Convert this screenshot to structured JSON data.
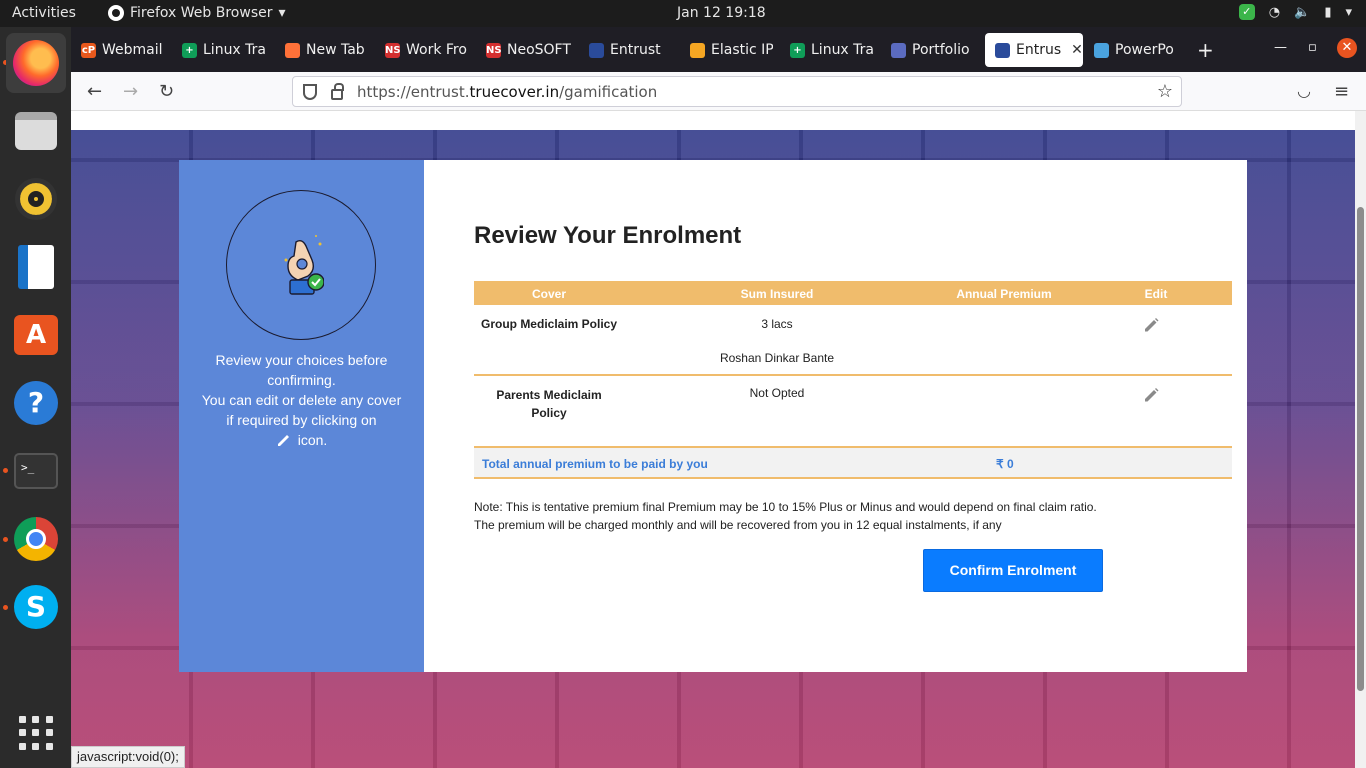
{
  "topbar": {
    "activities": "Activities",
    "app_name": "Firefox Web Browser",
    "clock": "Jan 12  19:18"
  },
  "dock": {
    "items": [
      "firefox",
      "files",
      "rhythmbox",
      "writer",
      "software",
      "help",
      "terminal",
      "chrome",
      "skype",
      "show-apps"
    ]
  },
  "tabs": [
    {
      "label": "Webmail",
      "favicon_color": "#e8581c",
      "favicon_text": "cP"
    },
    {
      "label": "Linux Tra",
      "favicon_color": "#0f9d58",
      "favicon_text": "+"
    },
    {
      "label": "New Tab",
      "favicon_color": "#ff7139",
      "favicon_text": ""
    },
    {
      "label": "Work Fro",
      "favicon_color": "#d32f2f",
      "favicon_text": "NS"
    },
    {
      "label": "NeoSOFT",
      "favicon_color": "#d32f2f",
      "favicon_text": "NS"
    },
    {
      "label": "Entrust",
      "favicon_color": "#2a4b9b",
      "favicon_text": ""
    },
    {
      "label": "Elastic IP",
      "favicon_color": "#f5a623",
      "favicon_text": ""
    },
    {
      "label": "Linux Tra",
      "favicon_color": "#0f9d58",
      "favicon_text": "+"
    },
    {
      "label": "Portfolio",
      "favicon_color": "#5b6bc0",
      "favicon_text": ""
    },
    {
      "label": "Entrus",
      "favicon_color": "#2a4b9b",
      "favicon_text": "",
      "active": true
    },
    {
      "label": "PowerPo",
      "favicon_color": "#4aa3df",
      "favicon_text": ""
    }
  ],
  "navbar": {
    "url_prefix": "https://entrust.",
    "url_host": "truecover.in",
    "url_path": "/gamification"
  },
  "sidebar": {
    "line1": "Review your choices before confirming.",
    "line2": "You can edit or delete any cover if required by clicking on",
    "line3": "icon."
  },
  "main": {
    "title": "Review Your Enrolment",
    "columns": [
      "Cover",
      "Sum Insured",
      "Annual Premium",
      "Edit"
    ],
    "rows": [
      {
        "cover": "Group Mediclaim Policy",
        "sum_insured": "3 lacs",
        "member": "Roshan Dinkar Bante",
        "premium": ""
      },
      {
        "cover": "Parents Mediclaim Policy",
        "sum_insured": "Not Opted",
        "premium": ""
      }
    ],
    "total_label": "Total annual premium to be paid by you",
    "total_amount": "₹ 0",
    "note_line1": "Note: This is tentative premium final Premium may be 10 to 15% Plus or Minus and would depend on final claim ratio.",
    "note_line2": "The premium will be charged monthly and will be recovered from you in 12 equal instalments, if any",
    "confirm_label": "Confirm Enrolment"
  },
  "status_text": "javascript:void(0);"
}
